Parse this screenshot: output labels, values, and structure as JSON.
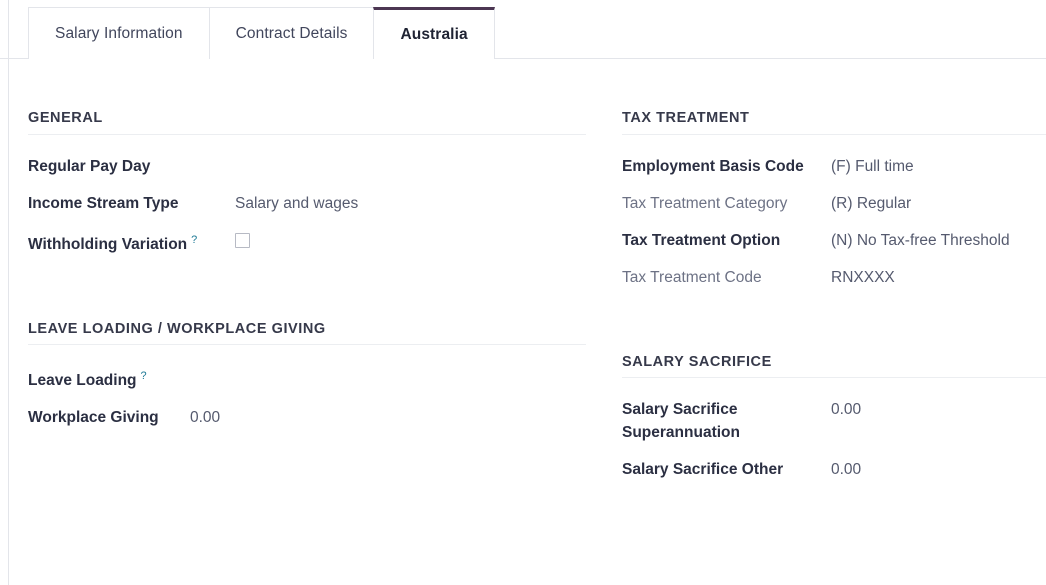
{
  "tabs": [
    {
      "label": "Salary Information",
      "active": false
    },
    {
      "label": "Contract Details",
      "active": false
    },
    {
      "label": "Australia",
      "active": true
    }
  ],
  "help_glyph": "?",
  "colors": {
    "active_tab_accent": "#4c3652",
    "help_link": "#1f7a96",
    "label": "#2b2f42",
    "muted_label": "#6d7285",
    "value": "#555a6e",
    "rule": "#e3e5ea"
  },
  "sections": {
    "general": {
      "title": "GENERAL",
      "fields": {
        "regular_pay_day": {
          "label": "Regular Pay Day",
          "value": ""
        },
        "income_stream_type": {
          "label": "Income Stream Type",
          "value": "Salary and wages"
        },
        "withholding_variation": {
          "label": "Withholding Variation",
          "value": "",
          "checked": false
        }
      }
    },
    "tax_treatment": {
      "title": "TAX TREATMENT",
      "fields": {
        "employment_basis_code": {
          "label": "Employment Basis Code",
          "value": "(F) Full time"
        },
        "tax_treatment_category": {
          "label": "Tax Treatment Category",
          "value": "(R) Regular"
        },
        "tax_treatment_option": {
          "label": "Tax Treatment Option",
          "value": "(N) No Tax-free Threshold"
        },
        "tax_treatment_code": {
          "label": "Tax Treatment Code",
          "value": "RNXXXX"
        }
      }
    },
    "leave_loading": {
      "title": "LEAVE LOADING / WORKPLACE GIVING",
      "fields": {
        "leave_loading": {
          "label": "Leave Loading",
          "value": ""
        },
        "workplace_giving": {
          "label": "Workplace Giving",
          "value": "0.00"
        }
      }
    },
    "salary_sacrifice": {
      "title": "SALARY SACRIFICE",
      "fields": {
        "salary_sacrifice_super": {
          "label": "Salary Sacrifice Superannuation",
          "value": "0.00"
        },
        "salary_sacrifice_other": {
          "label": "Salary Sacrifice Other",
          "value": "0.00"
        }
      }
    }
  }
}
